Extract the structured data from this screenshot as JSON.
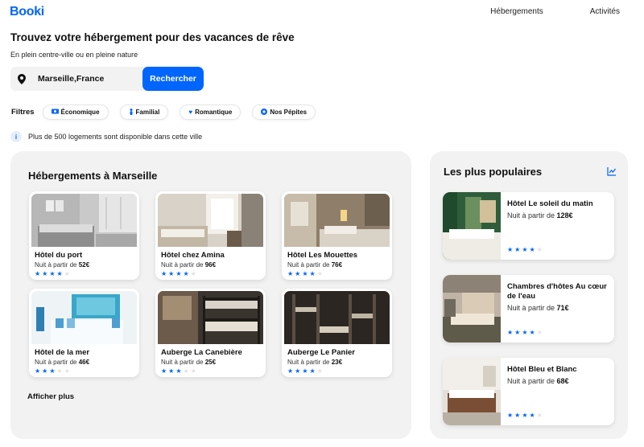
{
  "app": {
    "logo": "Booki"
  },
  "nav": {
    "items": [
      "Hébergements",
      "Activités"
    ]
  },
  "hero": {
    "title": "Trouvez votre hébergement pour des vacances de rêve",
    "subtitle": "En plein centre-ville ou en pleine nature"
  },
  "search": {
    "value": "Marseille,France",
    "button": "Rechercher",
    "icon": "location-pin-icon"
  },
  "filters": {
    "label": "Filtres",
    "items": [
      {
        "label": "Économique",
        "icon": "money-icon"
      },
      {
        "label": "Familial",
        "icon": "person-icon"
      },
      {
        "label": "Romantique",
        "icon": "heart-icon"
      },
      {
        "label": "Nos Pépites",
        "icon": "nugget-icon"
      }
    ]
  },
  "info": {
    "icon_text": "i",
    "text": "Plus de 500 logements sont disponible dans cette ville"
  },
  "accommodations": {
    "title": "Hébergements à Marseille",
    "price_prefix": "Nuit à partir de ",
    "show_more": "Afficher plus",
    "items": [
      {
        "name": "Hôtel du port",
        "price": "52€",
        "rating": 4
      },
      {
        "name": "Hôtel chez Amina",
        "price": "96€",
        "rating": 4
      },
      {
        "name": "Hôtel Les Mouettes",
        "price": "76€",
        "rating": 4
      },
      {
        "name": "Hôtel de la mer",
        "price": "46€",
        "rating": 3
      },
      {
        "name": "Auberge La Canebière",
        "price": "25€",
        "rating": 3
      },
      {
        "name": "Auberge Le Panier",
        "price": "23€",
        "rating": 4
      }
    ]
  },
  "popular": {
    "title": "Les plus populaires",
    "icon": "trend-icon",
    "price_prefix": "Nuit à partir de ",
    "items": [
      {
        "name": "Hôtel Le soleil du matin",
        "price": "128€",
        "rating": 4
      },
      {
        "name": "Chambres d'hôtes Au cœur de l'eau",
        "price": "71€",
        "rating": 4
      },
      {
        "name": "Hôtel Bleu et Blanc",
        "price": "68€",
        "rating": 4
      }
    ]
  },
  "colors": {
    "accent": "#0065FC",
    "panel": "#F2F2F2",
    "star_off": "#E2E2E2"
  }
}
